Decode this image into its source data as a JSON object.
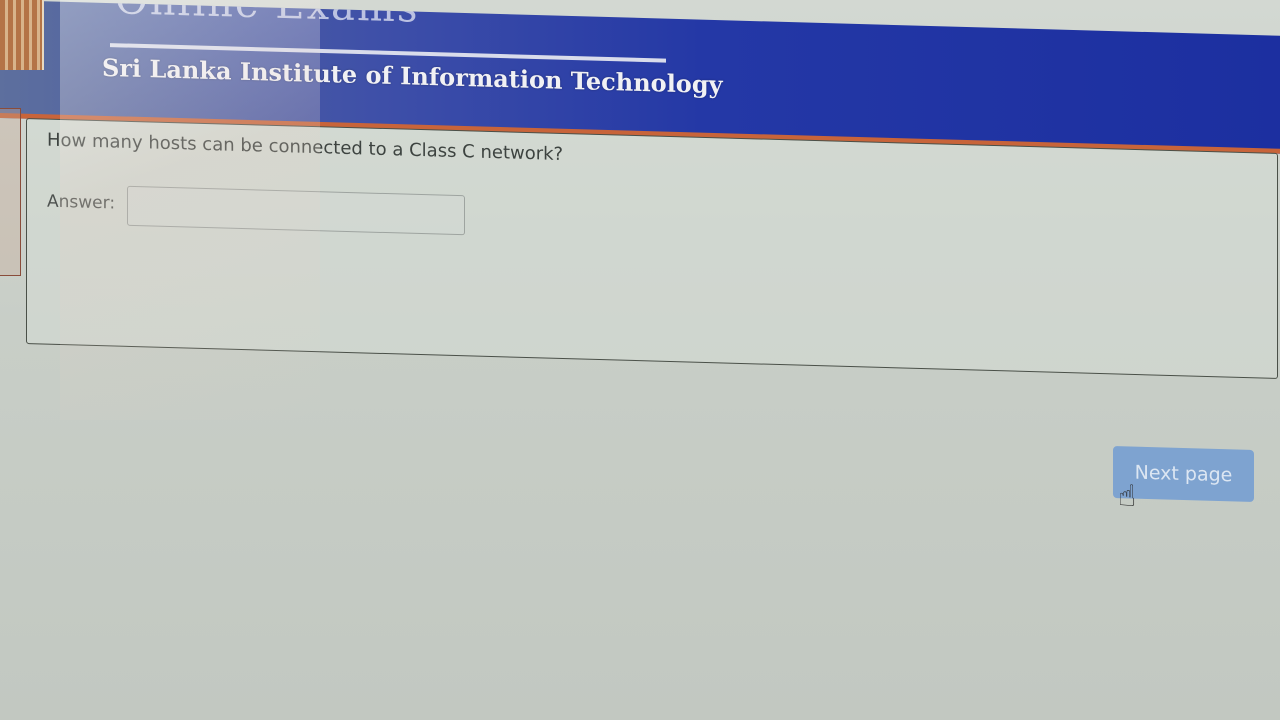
{
  "banner": {
    "top_text": "Online Exams",
    "subtitle": "Sri Lanka Institute of Information Technology"
  },
  "question": {
    "text": "How many hosts can be connected to a Class C network?",
    "answer_label": "Answer:",
    "answer_value": ""
  },
  "navigation": {
    "next_label": "Next page"
  },
  "icons": {
    "cursor": "hand-pointer-icon"
  },
  "colors": {
    "banner_blue": "#2438a6",
    "accent_stripe": "#c8643a",
    "button_blue": "#7ea3d0"
  }
}
